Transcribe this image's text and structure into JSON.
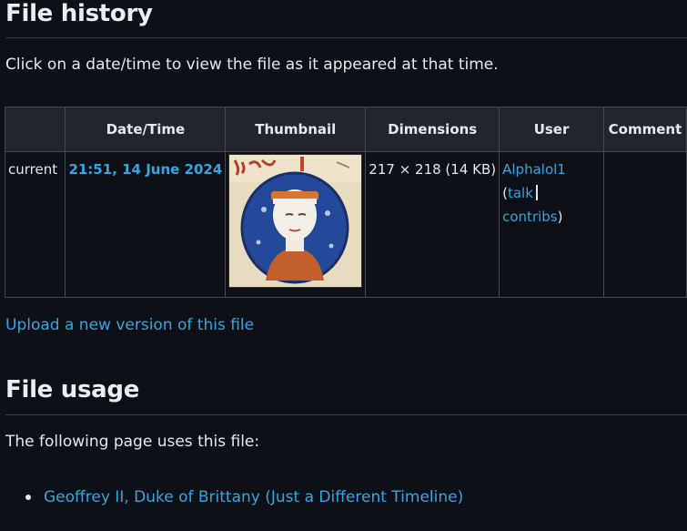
{
  "file_history": {
    "heading": "File history",
    "intro": "Click on a date/time to view the file as it appeared at that time.",
    "columns": [
      "",
      "Date/Time",
      "Thumbnail",
      "Dimensions",
      "User",
      "Comment"
    ],
    "rows": [
      {
        "status": "current",
        "datetime": "21:51, 14 June 2024",
        "thumbnail_icon": "portrait-thumbnail",
        "dimensions": "217 × 218 (14 KB)",
        "user": "Alphalol1",
        "open_paren": "(",
        "talk": "talk",
        "contribs": "contribs",
        "close_paren": ")",
        "comment": ""
      }
    ],
    "upload_link": "Upload a new version of this file"
  },
  "file_usage": {
    "heading": "File usage",
    "intro": "The following page uses this file:",
    "pages": [
      "Geoffrey II, Duke of Brittany (Just a Different Timeline)"
    ]
  },
  "colors": {
    "background": "#0d1017",
    "link": "#36a6e0",
    "header_bg": "#22252c",
    "border": "#454952"
  }
}
